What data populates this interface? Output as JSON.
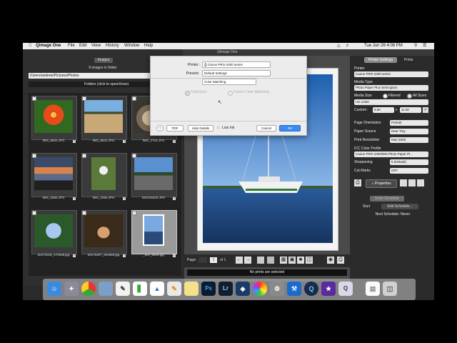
{
  "menubar": {
    "app": "Qimage One",
    "items": [
      "File",
      "Edit",
      "View",
      "History",
      "Window",
      "Help"
    ],
    "clock": "Tue Jun 26  4:08 PM"
  },
  "window": {
    "title": "Qimage One"
  },
  "left": {
    "images_button": "Images",
    "count": "9 images in folder",
    "path": "/Users/andrew/Pictures/Photos",
    "folders": "Folders (click to open/close)",
    "thumbs": [
      {
        "name": "IMG_6941.JPG"
      },
      {
        "name": "IMG_6541.JPG"
      },
      {
        "name": "IMG_4763.JPG"
      },
      {
        "name": "IMG_2062.JPG"
      },
      {
        "name": "IMG_1054.JPG"
      },
      {
        "name": "DSCN5020.JPG"
      },
      {
        "name": "20170319_170335.jpg"
      },
      {
        "name": "20170307_201650.jpg"
      },
      {
        "name": "_MG_9805.jpg"
      }
    ]
  },
  "dialog": {
    "printer_label": "Printer:",
    "printer_value": "Canon PRO-1000 series",
    "presets_label": "Presets:",
    "presets_value": "Default Settings",
    "pane_value": "Color Matching",
    "colorsync": "ColorSync",
    "canon": "Canon Color Matching",
    "help": "?",
    "pdf": "PDF",
    "hide_details": "Hide Details",
    "low_ink": "Low Ink",
    "cancel": "Cancel",
    "ok": "OK"
  },
  "preview": {
    "page_label": "Page:",
    "page_num": "1",
    "of": "of 1",
    "status": "No prints are selected"
  },
  "right": {
    "tab_settings": "Printer Settings",
    "tab_prints": "Prints",
    "printer_label": "Printer",
    "printer_value": "Canon PRO-1000 series",
    "media_type_label": "Media Type",
    "media_type_value": "Photo Paper Plus Semi-gloss",
    "media_size_label": "Media Size",
    "filtered": "Filtered",
    "all_sizes": "All Sizes",
    "media_size_value": "US Letter",
    "custom_label": "Custom:",
    "custom_w": "8.50",
    "custom_x": "x",
    "custom_h": "11.00",
    "orientation_label": "Page Orientation",
    "orientation_value": "Portrait",
    "source_label": "Paper Source",
    "source_value": "Rear Tray",
    "resolution_label": "Print Resolution",
    "resolution_value": "Max (600)",
    "icc_label": "ICC Color Profile",
    "icc_value": "Canon PRO-1000/500 Photo Paper Pl...",
    "sharpening_label": "Sharpening",
    "sharpening_value": "5 (Default)",
    "cutmarks_label": "Cut Marks",
    "cutmarks_value": "OFF",
    "properties": "Properties",
    "undo_schedule": "Undo Schedule",
    "start": "Start",
    "edit_schedule": "Edit Schedule...",
    "next_schedule": "Next Schedule: Never"
  },
  "dock_icons": [
    "finder-icon",
    "launchpad-icon",
    "chrome-icon",
    "preview-icon",
    "textedit-icon",
    "numbers-icon",
    "keynote-icon",
    "pages-icon",
    "notes-icon",
    "photoshop-icon",
    "lightroom-icon",
    "capture-icon",
    "photos-icon",
    "settings-icon",
    "xcode-icon",
    "quicktime-icon",
    "star-icon",
    "qimage-icon",
    "document-icon",
    "trash-icon"
  ]
}
